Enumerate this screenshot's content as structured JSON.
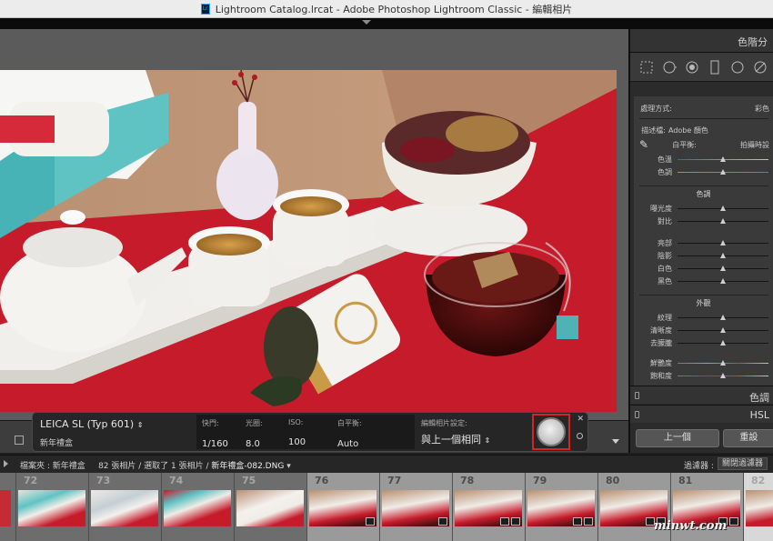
{
  "window": {
    "title": "Lightroom Catalog.lrcat - Adobe Photoshop Lightroom Classic - 編輯相片",
    "app_icon_text": "Lr"
  },
  "right_panel": {
    "header": "色階分",
    "tools": [
      "crop-overlay-icon",
      "spot-removal-icon",
      "red-eye-icon",
      "graduated-filter-icon",
      "radial-filter-icon",
      "adjustment-brush-icon"
    ],
    "treatment_label": "處理方式:",
    "treatment_value": "彩色",
    "profile_label": "描述檔:",
    "profile_value": "Adobe 顏色",
    "wb_label": "白平衡:",
    "wb_value": "拍攝時設",
    "temp_label": "色溫",
    "tint_label": "色調",
    "tone_group": "色調",
    "exposure_label": "曝光度",
    "contrast_label": "對比",
    "highlights_label": "亮部",
    "shadows_label": "陰影",
    "whites_label": "白色",
    "blacks_label": "黑色",
    "presence_group": "外觀",
    "texture_label": "紋理",
    "clarity_label": "清晰度",
    "dehaze_label": "去朦朧",
    "vibrance_label": "鮮艷度",
    "saturation_label": "飽和度",
    "tone_curve_panel": "色調",
    "hsl_panel": "HSL",
    "prev_button": "上一個",
    "reset_button": "重設"
  },
  "slider_levels": {
    "temp": 0.5,
    "tint": 0.5,
    "exposure": 0.5,
    "contrast": 0.5,
    "highlights": 0.5,
    "shadows": 0.5,
    "whites": 0.5,
    "blacks": 0.5,
    "texture": 0.5,
    "clarity": 0.5,
    "dehaze": 0.5,
    "vibrance": 0.5,
    "saturation": 0.5
  },
  "info_overlay": {
    "camera": "LEICA SL (Typ 601)",
    "folder": "新年禮盒",
    "shutter_label": "快門:",
    "shutter_value": "1/160",
    "aperture_label": "光圈:",
    "aperture_value": "8.0",
    "iso_label": "ISO:",
    "iso_value": "100",
    "wb_label": "白平衡:",
    "wb_value": "Auto",
    "edit_label": "編輯相片設定:",
    "edit_value": "與上一個相同"
  },
  "filmstrip_bar": {
    "folder_label": "檔案夾 : 新年禮盒",
    "count_text": "82 張相片 / 選取了 1 張相片 /",
    "filename": "新年禮盒-082.DNG",
    "filter_label": "過濾器 :",
    "filter_off_button": "關閉過濾器"
  },
  "filmstrip": [
    {
      "num": ""
    },
    {
      "num": "72"
    },
    {
      "num": "73"
    },
    {
      "num": "74"
    },
    {
      "num": "75"
    },
    {
      "num": "76"
    },
    {
      "num": "77"
    },
    {
      "num": "78"
    },
    {
      "num": "79"
    },
    {
      "num": "80"
    },
    {
      "num": "81"
    },
    {
      "num": "82"
    }
  ],
  "watermark": "minwt.com",
  "colors": {
    "accent": "#d92222",
    "panel": "#2b2b2b",
    "background": "#5b5b5b"
  }
}
